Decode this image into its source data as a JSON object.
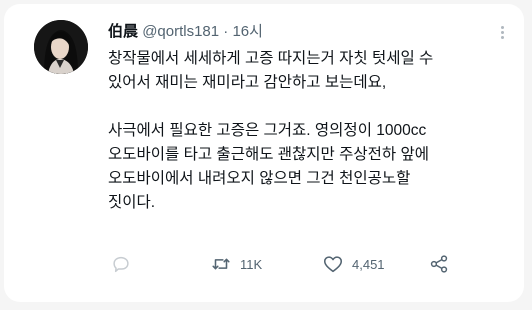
{
  "tweet": {
    "display_name": "伯晨",
    "handle": "@qortls181",
    "separator": "·",
    "time": "16시",
    "paragraphs": [
      "창작물에서 세세하게 고증 따지는거 자칫 텃세일 수\n있어서 재미는 재미라고 감안하고 보는데요,",
      "사극에서 필요한 고증은 그거죠. 영의정이 1000cc\n오도바이를 타고 출근해도 괜찮지만 주상전하 앞에\n오도바이에서 내려오지 않으면 그건 천인공노할\n짓이다."
    ],
    "actions": {
      "reply_icon": "reply-icon",
      "retweet_icon": "retweet-icon",
      "retweet_count": "11K",
      "like_icon": "heart-icon",
      "like_count": "4,451",
      "share_icon": "share-icon"
    },
    "colors": {
      "text": "#0f1419",
      "muted": "#536471",
      "background": "#ffffff"
    }
  }
}
